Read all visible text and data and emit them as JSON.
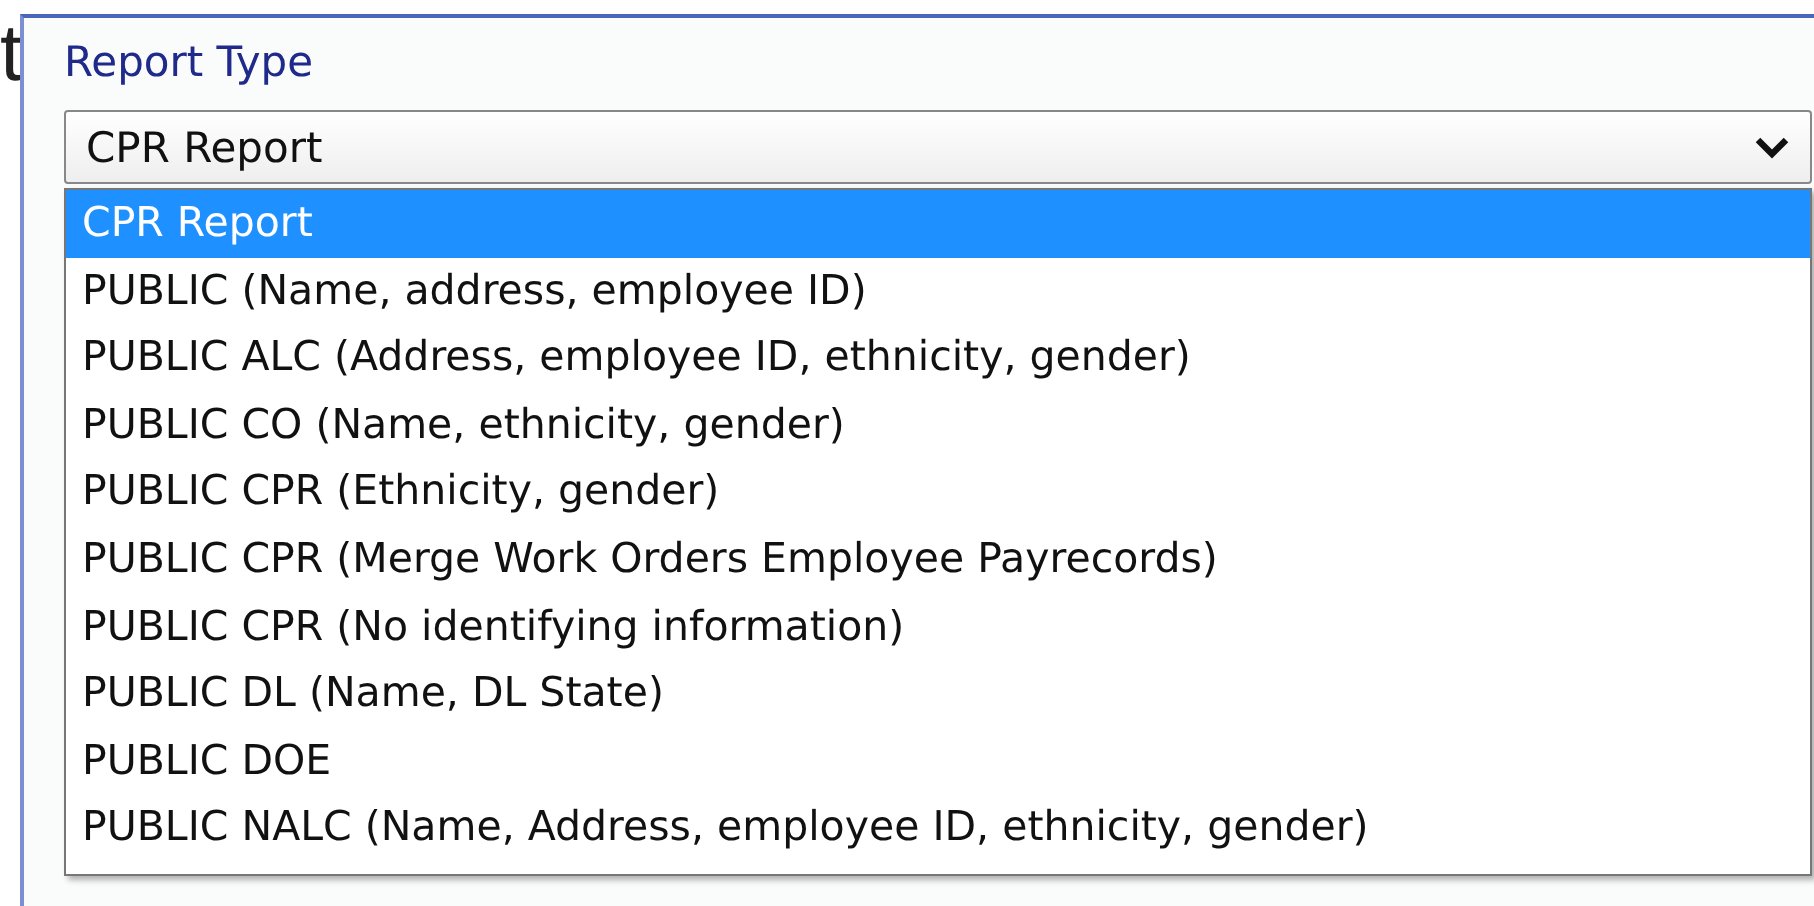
{
  "background_text": [
    "t"
  ],
  "report_type": {
    "label": "Report Type",
    "value": "CPR Report",
    "options": [
      {
        "label": "CPR Report",
        "selected": true
      },
      {
        "label": "PUBLIC (Name, address, employee ID)",
        "selected": false
      },
      {
        "label": "PUBLIC ALC (Address, employee ID, ethnicity, gender)",
        "selected": false
      },
      {
        "label": "PUBLIC CO (Name, ethnicity, gender)",
        "selected": false
      },
      {
        "label": "PUBLIC CPR (Ethnicity, gender)",
        "selected": false
      },
      {
        "label": "PUBLIC CPR (Merge Work Orders Employee Payrecords)",
        "selected": false
      },
      {
        "label": "PUBLIC CPR (No identifying information)",
        "selected": false
      },
      {
        "label": "PUBLIC DL (Name, DL State)",
        "selected": false
      },
      {
        "label": "PUBLIC DOE",
        "selected": false
      },
      {
        "label": "PUBLIC NALC (Name, Address, employee ID, ethnicity, gender)",
        "selected": false
      }
    ]
  }
}
